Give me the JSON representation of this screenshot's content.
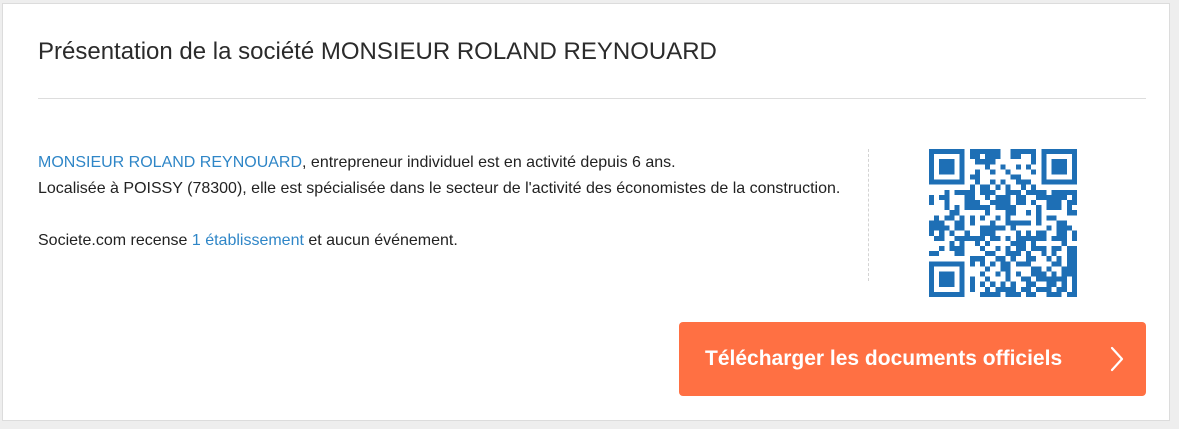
{
  "panel": {
    "title": "Présentation de la société MONSIEUR ROLAND REYNOUARD"
  },
  "description": {
    "company_link": "MONSIEUR ROLAND REYNOUARD",
    "sentence_1": ", entrepreneur individuel est en activité depuis 6 ans.",
    "sentence_2": "Localisée à POISSY (78300), elle est spécialisée dans le secteur de l'activité des économistes de la construction.",
    "recense_prefix": "Societe.com recense ",
    "establishment_link": "1 établissement",
    "recense_suffix": " et aucun événement."
  },
  "qr_code": {
    "icon": "qr-code-icon",
    "color": "#1e6fb5"
  },
  "download_button": {
    "label": "Télécharger les documents officiels",
    "icon": "chevron-right-icon",
    "color": "#ff7043"
  },
  "colors": {
    "link": "#2f86c7",
    "text": "#222222",
    "background": "#eeeeee"
  }
}
